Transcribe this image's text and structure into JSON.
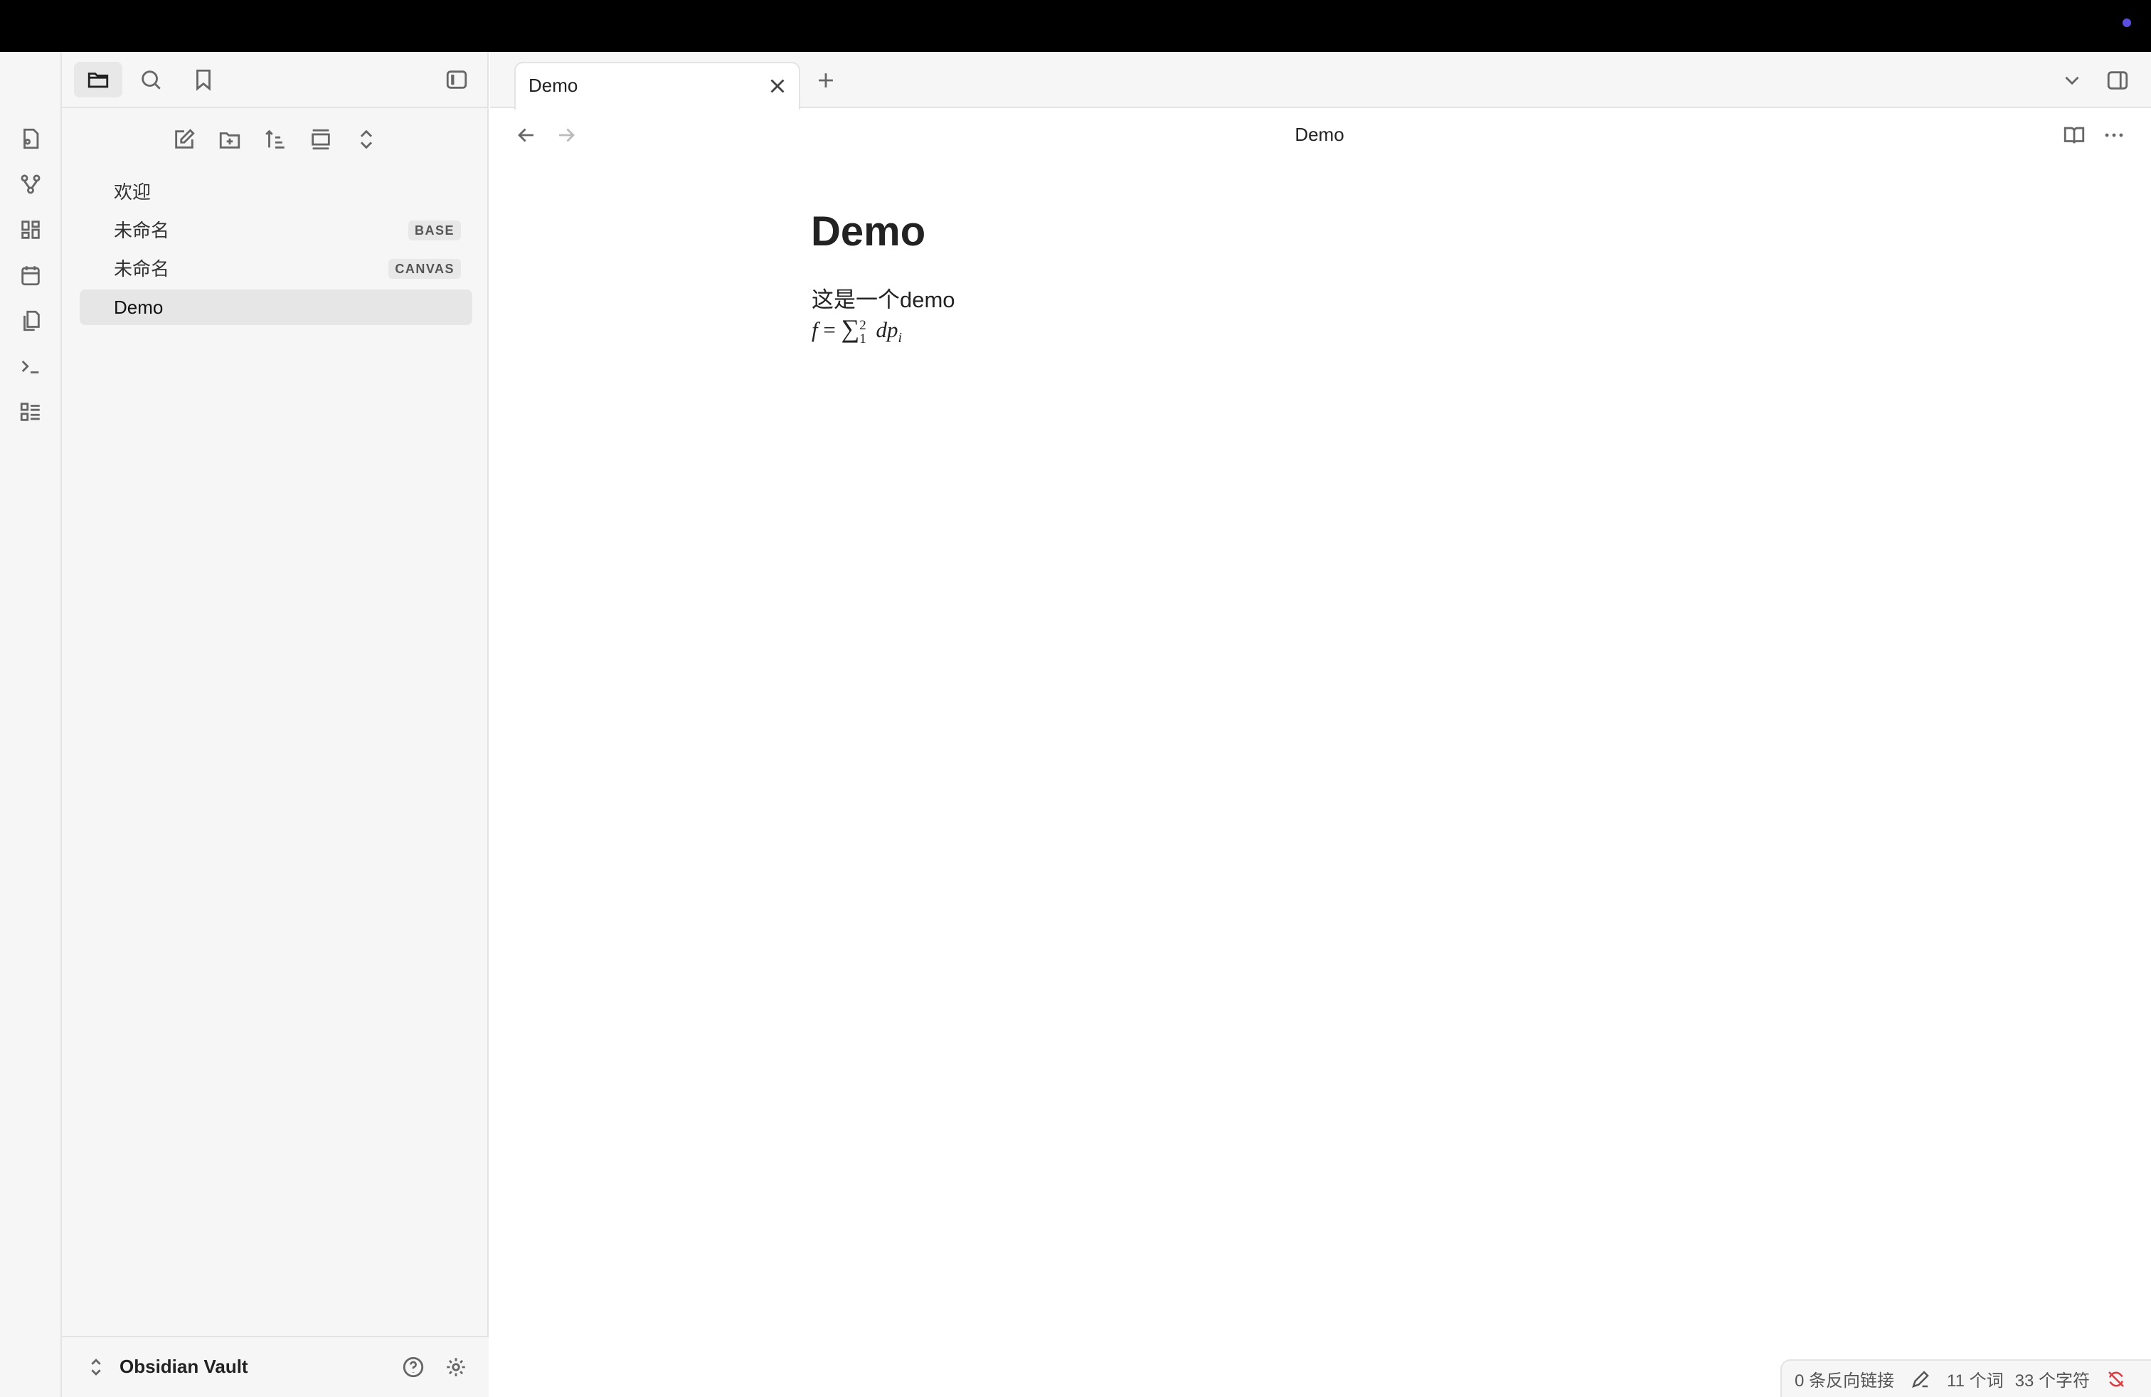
{
  "sidebar": {
    "tabs": [
      "folder-icon",
      "search-icon",
      "bookmark-icon"
    ],
    "items": [
      {
        "label": "欢迎",
        "badge": ""
      },
      {
        "label": "未命名",
        "badge": "BASE"
      },
      {
        "label": "未命名",
        "badge": "CANVAS"
      },
      {
        "label": "Demo",
        "badge": "",
        "active": true
      }
    ],
    "vault_name": "Obsidian Vault"
  },
  "ribbon": [
    "quick-switcher-icon",
    "graph-icon",
    "canvas-icon",
    "daily-note-icon",
    "templates-icon",
    "command-palette-icon",
    "bases-icon"
  ],
  "tab": {
    "title": "Demo"
  },
  "view": {
    "title": "Demo"
  },
  "note": {
    "heading": "Demo",
    "paragraph": "这是一个demo",
    "formula": "f = ∑_1^2 dp_i"
  },
  "status": {
    "backlinks": "0 条反向链接",
    "words": "11 个词",
    "chars": "33 个字符",
    "sync_color": "#e0393e"
  },
  "colors": {
    "accent": "#5b4fe0"
  }
}
